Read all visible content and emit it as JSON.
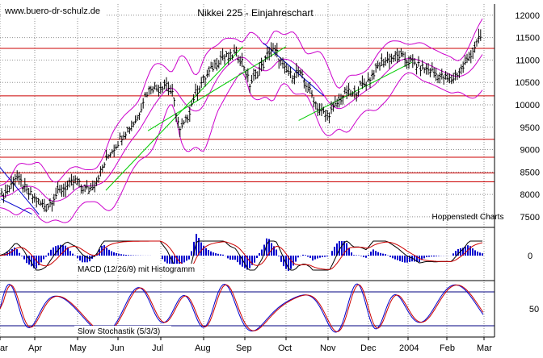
{
  "chart_data": [
    {
      "type": "line",
      "name": "price-panel",
      "title": "Nikkei 225 - Einjahreschart",
      "watermark": "www.buero-dr-schulz.de",
      "credit": "Hoppenstedt Charts",
      "style": "ohlc-bars",
      "ylim": [
        7300,
        12250
      ],
      "yticks": [
        7500,
        8000,
        8500,
        9000,
        9500,
        10000,
        10500,
        11000,
        11500,
        12000
      ],
      "horizontal_levels": [
        8280,
        8480,
        8830,
        9230,
        10200,
        11260
      ],
      "trend_lines": [
        {
          "from": [
            0.03,
            7900
          ],
          "to": [
            0.92,
            7560
          ],
          "label": ""
        },
        {
          "from": [
            3.4,
            8100
          ],
          "to": [
            5.95,
            11320
          ],
          "label": ""
        },
        {
          "from": [
            0.05,
            8150
          ],
          "to": [
            0.0,
            0.0
          ],
          "label": ""
        }
      ],
      "series": [
        {
          "name": "",
          "color": "#000000",
          "x": [
            -0.05,
            0.12,
            0.28,
            0.45,
            0.62,
            0.78,
            0.95,
            1.12,
            1.28,
            1.45,
            1.62,
            1.78,
            1.95,
            2.12,
            2.28,
            2.45,
            2.62,
            2.78,
            2.95,
            3.12,
            3.28,
            3.45,
            3.62,
            3.78,
            3.95,
            4.12,
            4.28,
            4.45,
            4.62,
            4.78,
            4.95,
            5.12,
            5.28,
            5.45,
            5.62,
            5.78,
            5.95,
            6.12,
            6.28,
            6.45,
            6.62,
            6.78,
            6.95,
            7.12,
            7.28,
            7.45,
            7.62,
            7.78,
            7.95,
            8.12,
            8.28,
            8.45,
            8.62,
            8.78,
            8.95,
            9.12,
            9.28,
            9.45,
            9.62,
            9.78,
            9.95,
            10.12,
            10.28,
            10.45,
            10.62,
            10.78,
            10.95,
            11.12,
            11.28,
            11.45,
            11.62,
            11.78,
            11.95
          ],
          "values": [
            7950,
            8000,
            8150,
            8400,
            8250,
            8050,
            7950,
            7800,
            7700,
            7950,
            8100,
            8200,
            8300,
            8150,
            8100,
            8300,
            8600,
            8900,
            9100,
            9350,
            9500,
            9700,
            10200,
            10400,
            10350,
            10500,
            10200,
            9400,
            9700,
            10200,
            10500,
            10700,
            10900,
            11100,
            11050,
            11150,
            10950,
            10450,
            10700,
            10900,
            11250,
            11150,
            10800,
            10650,
            10750,
            10500,
            10200,
            9900,
            9750,
            9900,
            10100,
            10300,
            10200,
            10400,
            10500,
            10700,
            10900,
            11000,
            11050,
            11100,
            11000,
            10950,
            10850,
            10800,
            10750,
            10650,
            10600,
            10550,
            10700,
            10850,
            11100,
            11350,
            11550
          ]
        }
      ],
      "bands": [
        {
          "name": "",
          "color": "#cc00cc"
        }
      ]
    },
    {
      "type": "line",
      "name": "macd-panel",
      "label": "MACD (12/26/9) mit Histogramm",
      "yticks": [
        0
      ],
      "ylim": [
        -1,
        1
      ],
      "series": [
        {
          "name": "",
          "color": "#000000"
        },
        {
          "name": "",
          "color": "#cc0000"
        }
      ],
      "histogram_color": "#0000cc"
    },
    {
      "type": "line",
      "name": "stochastic-panel",
      "label": "Slow Stochastik (5/3/3)",
      "ylim": [
        0,
        100
      ],
      "yticks": [
        50
      ],
      "horizontal_levels": [
        20,
        80
      ],
      "series": [
        {
          "name": "",
          "color": "#0000cc"
        },
        {
          "name": "",
          "color": "#cc0000"
        }
      ]
    }
  ],
  "x_axis": {
    "months": [
      "Apr",
      "May",
      "Jun",
      "Jul",
      "Aug",
      "Sep",
      "Oct",
      "Nov",
      "Dec",
      "2004",
      "Feb",
      "Mar"
    ],
    "first_label_fragment": "ar"
  },
  "colors": {
    "grid": "#909090",
    "bar": "#000000",
    "band": "#cc00cc",
    "trend": "#00cc00",
    "trend_down": "#0000cc",
    "level": "#cc0000",
    "histogram": "#0000cc",
    "stoch_fast": "#0000cc",
    "stoch_slow": "#cc0000",
    "macd": "#000000",
    "signal": "#cc0000"
  }
}
